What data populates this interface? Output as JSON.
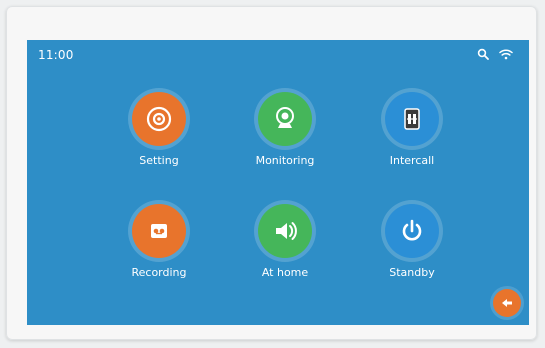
{
  "status_bar": {
    "time": "11:00",
    "icons": [
      "search-icon",
      "wifi-icon"
    ]
  },
  "apps": [
    {
      "label": "Setting",
      "icon": "gear-icon",
      "color": "#e8742c"
    },
    {
      "label": "Monitoring",
      "icon": "camera-icon",
      "color": "#45b65a"
    },
    {
      "label": "Intercall",
      "icon": "intercom-icon",
      "color": "#2b8fd6"
    },
    {
      "label": "Recording",
      "icon": "recording-icon",
      "color": "#e8742c"
    },
    {
      "label": "At home",
      "icon": "speaker-icon",
      "color": "#45b65a"
    },
    {
      "label": "Standby",
      "icon": "power-icon",
      "color": "#2b8fd6"
    }
  ],
  "fab": {
    "icon": "back-icon",
    "color": "#e8742c"
  },
  "colors": {
    "screen_bg": "#2e8ec7",
    "accent_orange": "#e8742c",
    "accent_green": "#45b65a",
    "accent_blue": "#2b8fd6"
  }
}
